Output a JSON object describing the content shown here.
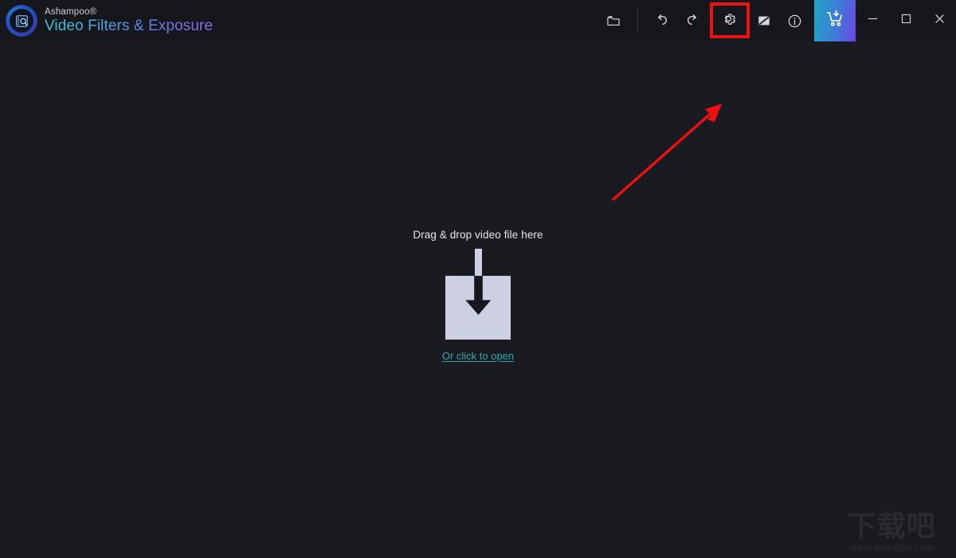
{
  "window": {
    "brand_sub": "Ashampoo®",
    "brand_title": "Video Filters & Exposure",
    "logo_icon": "film-magnifier-icon",
    "accent_start": "#1fa6c4",
    "accent_end": "#6c47e3",
    "background": "#1a1a21",
    "titlebar_background": "#16161d"
  },
  "toolbar": {
    "items": [
      {
        "name": "open-folder-button",
        "icon": "folder-icon",
        "label": "Open file"
      },
      {
        "name": "undo-button",
        "icon": "undo-arrow-icon",
        "label": "Undo"
      },
      {
        "name": "redo-button",
        "icon": "redo-arrow-icon",
        "label": "Redo"
      },
      {
        "name": "settings-button",
        "icon": "gear-icon",
        "label": "Settings"
      },
      {
        "name": "curves-button",
        "icon": "tone-curve-icon",
        "label": "Adjustments"
      },
      {
        "name": "info-button",
        "icon": "info-circle-icon",
        "label": "Info"
      },
      {
        "name": "buy-button",
        "icon": "shopping-cart-icon",
        "label": "Buy now"
      }
    ],
    "window_controls": [
      {
        "name": "minimize-button",
        "icon": "minimize-icon",
        "label": "Minimize"
      },
      {
        "name": "maximize-button",
        "icon": "maximize-icon",
        "label": "Maximize"
      },
      {
        "name": "close-button",
        "icon": "close-icon",
        "label": "Close"
      }
    ]
  },
  "dropzone": {
    "label": "Drag & drop video file here",
    "link": "Or click to open",
    "icon": "download-into-box-icon",
    "box_color": "#ccd0e2",
    "link_color": "#2fa8ad"
  },
  "annotation": {
    "name": "red-pointer-arrow",
    "color": "#ee1111",
    "points_to": "settings-button",
    "highlight_box_color": "#ee1111"
  },
  "watermark": {
    "text_cn": "下载吧",
    "url": "www.xiazaiba.com",
    "color": "#2a2a33"
  }
}
